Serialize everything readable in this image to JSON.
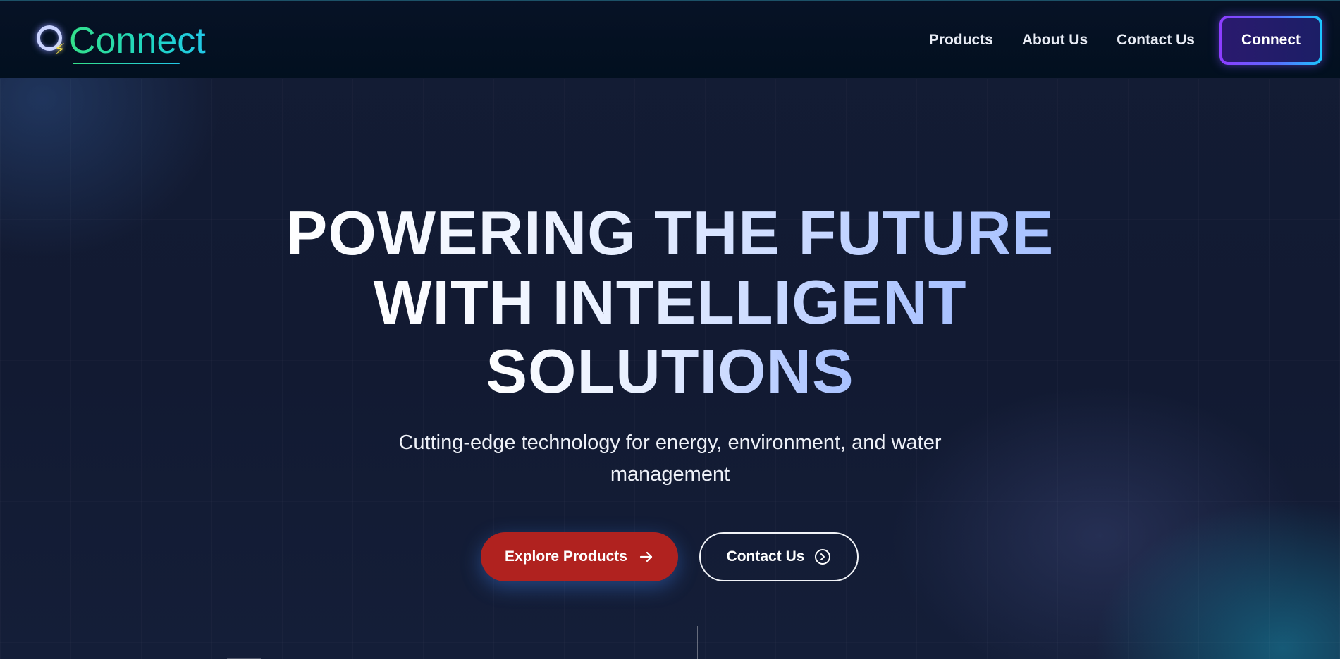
{
  "header": {
    "logo_text": "Connect",
    "logo_icon": "power-ring-bolt-icon",
    "nav": [
      {
        "label": "Products"
      },
      {
        "label": "About Us"
      },
      {
        "label": "Contact Us"
      }
    ],
    "connect_label": "Connect"
  },
  "hero": {
    "title_lines": [
      "POWERING THE FUTURE",
      "WITH INTELLIGENT",
      "SOLUTIONS"
    ],
    "subtitle_lines": [
      "Cutting-edge technology for energy, environment, and water",
      "management"
    ],
    "primary_cta": {
      "label": "Explore Products",
      "icon": "arrow-right-icon"
    },
    "secondary_cta": {
      "label": "Contact Us",
      "icon": "chevron-right-circle-icon"
    }
  },
  "colors": {
    "background": "#121a32",
    "header_bg": "#02101f",
    "primary_button": "#b0221f",
    "logo_gradient_start": "#34e08a",
    "logo_gradient_end": "#22c8e8",
    "connect_border_start": "#8d3cff",
    "connect_border_end": "#1ac8ff",
    "title_gradient_end": "#a6c0ff"
  }
}
